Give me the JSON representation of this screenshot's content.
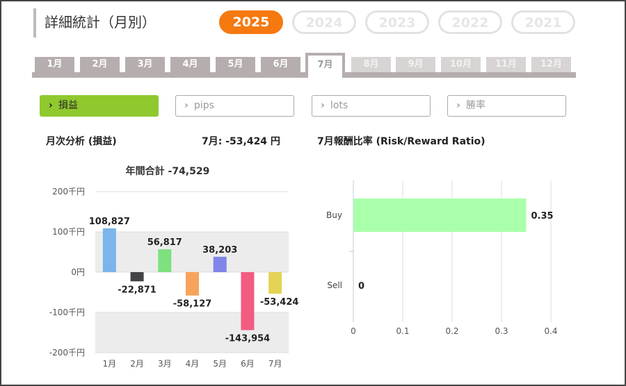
{
  "page": {
    "title": "詳細統計（月別）"
  },
  "years": [
    {
      "label": "2025",
      "active": true
    },
    {
      "label": "2024",
      "active": false
    },
    {
      "label": "2023",
      "active": false
    },
    {
      "label": "2022",
      "active": false
    },
    {
      "label": "2021",
      "active": false
    }
  ],
  "months": [
    {
      "label": "1月",
      "state": "enabled"
    },
    {
      "label": "2月",
      "state": "enabled"
    },
    {
      "label": "3月",
      "state": "enabled"
    },
    {
      "label": "4月",
      "state": "enabled"
    },
    {
      "label": "5月",
      "state": "enabled"
    },
    {
      "label": "6月",
      "state": "enabled"
    },
    {
      "label": "7月",
      "state": "active"
    },
    {
      "label": "8月",
      "state": "disabled"
    },
    {
      "label": "9月",
      "state": "disabled"
    },
    {
      "label": "10月",
      "state": "disabled"
    },
    {
      "label": "11月",
      "state": "disabled"
    },
    {
      "label": "12月",
      "state": "disabled"
    }
  ],
  "filters": [
    {
      "label": "損益",
      "active": true
    },
    {
      "label": "pips",
      "active": false
    },
    {
      "label": "lots",
      "active": false
    },
    {
      "label": "勝率",
      "active": false
    }
  ],
  "left_panel": {
    "heading": "月次分析 (損益)",
    "month_summary": "7月:  -53,424 円"
  },
  "right_panel": {
    "heading": "7月報酬比率 (Risk/Reward Ratio)"
  },
  "colors": {
    "accent": "#f5790f",
    "active_filter": "#8fc92e",
    "tab_gray": "#b6aeae"
  },
  "chart_data": [
    {
      "type": "bar",
      "title": "年間合計 -74,529",
      "categories": [
        "1月",
        "2月",
        "3月",
        "4月",
        "5月",
        "6月",
        "7月"
      ],
      "values": [
        108827,
        -22871,
        56817,
        -58127,
        38203,
        -143954,
        -53424
      ],
      "value_labels": [
        "108,827",
        "-22,871",
        "56,817",
        "-58,127",
        "38,203",
        "-143,954",
        "-53,424"
      ],
      "bar_colors": [
        "#7cb5ec",
        "#434348",
        "#7fe07f",
        "#f7a35c",
        "#8085e9",
        "#f15c80",
        "#e4d354"
      ],
      "ylim": [
        -200000,
        200000
      ],
      "yticks": [
        200000,
        100000,
        0,
        -100000,
        -200000
      ],
      "ytick_labels": [
        "200千円",
        "100千円",
        "0円",
        "-100千円",
        "-200千円"
      ]
    },
    {
      "type": "bar",
      "orientation": "horizontal",
      "categories": [
        "Buy",
        "Sell"
      ],
      "values": [
        0.35,
        0
      ],
      "value_labels": [
        "0.35",
        "0"
      ],
      "bar_color": "#aaffaa",
      "xlim": [
        0,
        0.4
      ],
      "xticks": [
        0,
        0.1,
        0.2,
        0.3,
        0.4
      ],
      "xtick_labels": [
        "0",
        "0.1",
        "0.2",
        "0.3",
        "0.4"
      ],
      "grid": true
    }
  ]
}
